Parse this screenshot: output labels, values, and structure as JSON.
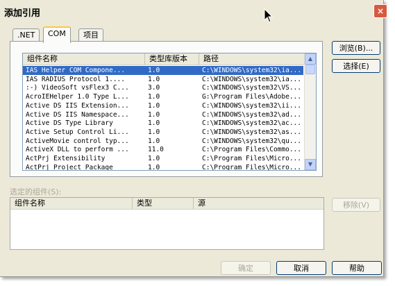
{
  "window": {
    "title": "添加引用",
    "close_label": "×"
  },
  "tabs": [
    {
      "label": ".NET"
    },
    {
      "label": "COM"
    },
    {
      "label": "项目"
    }
  ],
  "components_list": {
    "columns": [
      "组件名称",
      "类型库版本",
      "路径"
    ],
    "rows": [
      [
        "IAS Helper COM Compone...",
        "1.0",
        "C:\\WINDOWS\\system32\\ia..."
      ],
      [
        "IAS RADIUS Protocol 1....",
        "1.0",
        "C:\\WINDOWS\\system32\\ia..."
      ],
      [
        ":-) VideoSoft vsFlex3 C...",
        "3.0",
        "C:\\WINDOWS\\system32\\VS..."
      ],
      [
        "AcroIEHelper 1.0 Type L...",
        "1.0",
        "G:\\Program Files\\Adobe..."
      ],
      [
        "Active DS IIS Extension...",
        "1.0",
        "C:\\WINDOWS\\system32\\ii..."
      ],
      [
        "Active DS IIS Namespace...",
        "1.0",
        "C:\\WINDOWS\\system32\\ad..."
      ],
      [
        "Active DS Type Library",
        "1.0",
        "C:\\WINDOWS\\system32\\ac..."
      ],
      [
        "Active Setup Control Li...",
        "1.0",
        "C:\\WINDOWS\\system32\\as..."
      ],
      [
        "ActiveMovie control typ...",
        "1.0",
        "C:\\WINDOWS\\system32\\qu..."
      ],
      [
        "ActiveX DLL to perform ...",
        "11.0",
        "C:\\Program Files\\Commo..."
      ],
      [
        "ActPrj Extensibility",
        "1.0",
        "C:\\Program Files\\Micro..."
      ],
      [
        "ActPrj Project Package",
        "1.0",
        "C:\\Program Files\\Micro..."
      ]
    ],
    "selected_index": 0
  },
  "buttons": {
    "browse": "浏览(B)...",
    "select": "选择(E)",
    "remove": "移除(V)",
    "ok": "确定",
    "cancel": "取消",
    "help": "帮助"
  },
  "selected_section": {
    "label": "选定的组件(S):",
    "columns": [
      "组件名称",
      "类型",
      "源"
    ]
  },
  "scroll_glyphs": {
    "up": "▲",
    "down": "▼"
  }
}
